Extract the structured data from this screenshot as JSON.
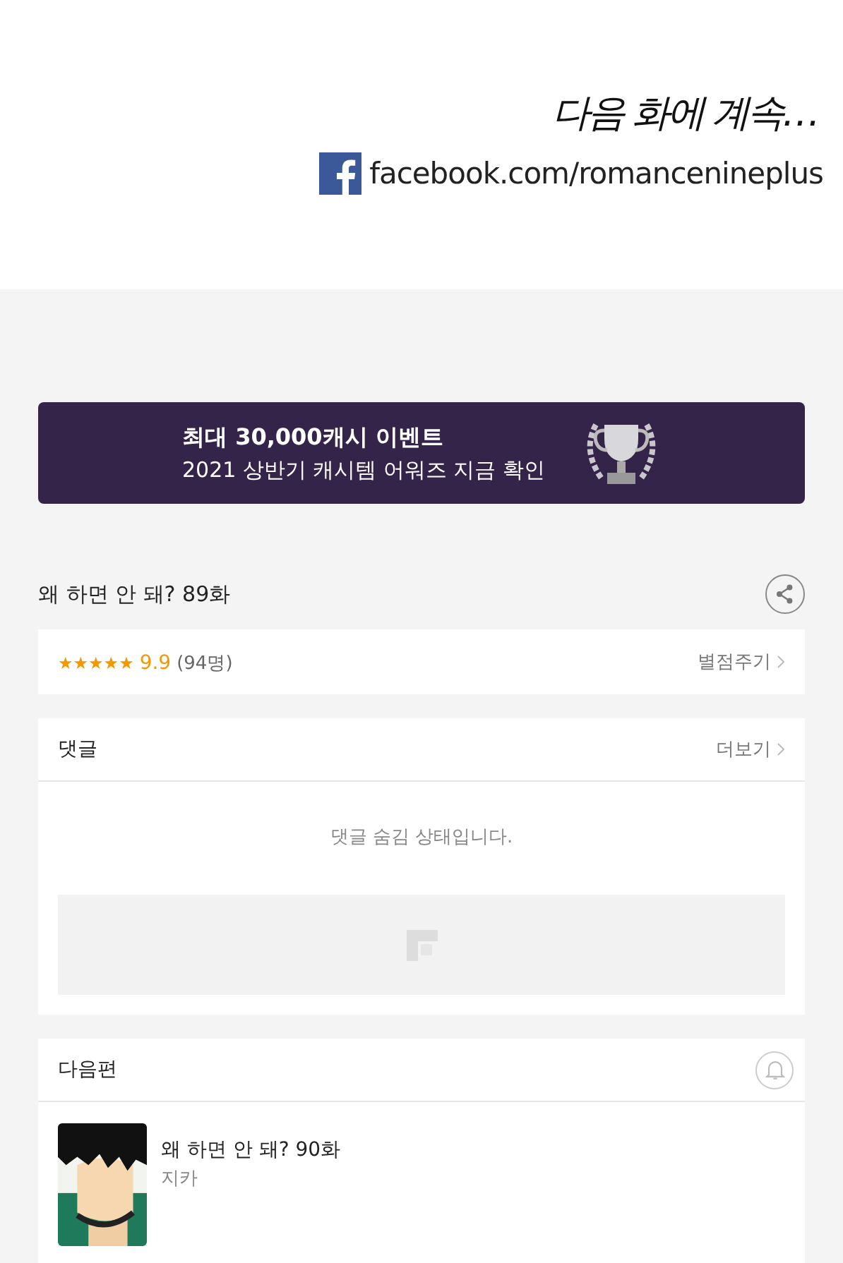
{
  "episode_end": {
    "continued": "다음 화에 계속…",
    "facebook_link": "facebook.com/romancenineplus"
  },
  "banner": {
    "title": "최대 30,000캐시 이벤트",
    "subtitle": "2021 상반기 캐시템 어워즈 지금 확인"
  },
  "episode": {
    "title": "왜 하면 안 돼? 89화"
  },
  "rating": {
    "stars": 5,
    "score": "9.9",
    "count": "(94명)",
    "rate_link": "별점주기"
  },
  "comments": {
    "title": "댓글",
    "more_link": "더보기",
    "notice": "댓글 숨김 상태입니다."
  },
  "next": {
    "title": "다음편",
    "episode_title": "왜 하면 안 돼? 90화",
    "author": "지카"
  }
}
